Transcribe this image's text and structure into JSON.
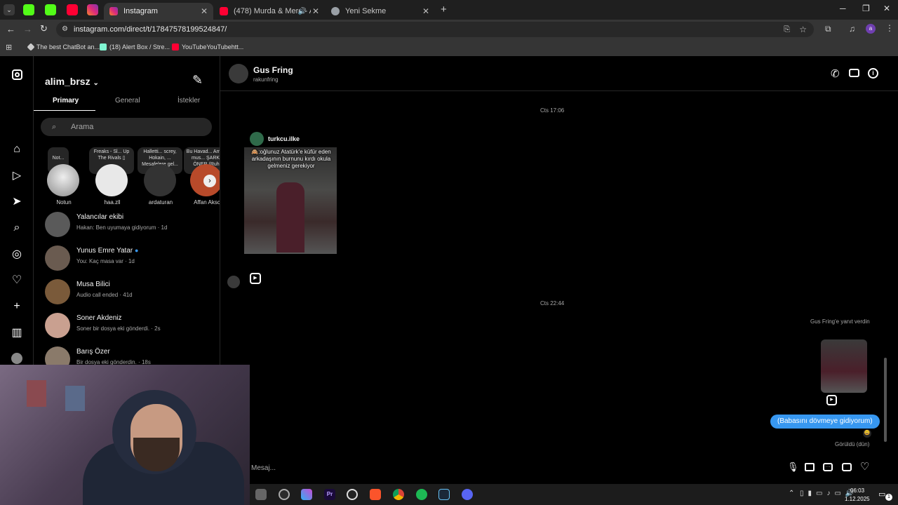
{
  "browser": {
    "tabs": [
      {
        "title": "Instagram",
        "active": true
      },
      {
        "title": "(478) Murda & Mero - Ara",
        "active": false
      },
      {
        "title": "Yeni Sekme",
        "active": false
      }
    ],
    "url": "instagram.com/direct/t/17847578199524847/",
    "bookmarks": [
      "The best ChatBot an...",
      "(18) Alert Box / Stre...",
      "YouTubeYouTubehtt..."
    ],
    "profile_initial": "a"
  },
  "inbox": {
    "username": "alim_brsz",
    "tabs": [
      "Primary",
      "General",
      "İstekler"
    ],
    "search_placeholder": "Arama",
    "notes": [
      {
        "bubble": "Not...",
        "name": "Notun"
      },
      {
        "bubble": "Freaks - Sl... Up The Rivals ▯",
        "name": "haa.zll"
      },
      {
        "bubble": "Halletti... screy, Hokain, ... Mesafelere gel...",
        "name": "ardaturan"
      },
      {
        "bubble": "Bu Havad... Armin mus... ŞARKI ÖNER (Ruh halinizi",
        "name": "Affan Aksc"
      }
    ],
    "conversations": [
      {
        "name": "Yalancılar ekibi",
        "preview": "Hakan: Ben uyumaya gidiyorum · 1d"
      },
      {
        "name": "Yunus Emre Yatar",
        "preview": "You: Kaç masa var · 1d",
        "verified": true
      },
      {
        "name": "Musa Bilici",
        "preview": "Audio call ended · 41d"
      },
      {
        "name": "Soner Akdeniz",
        "preview": "Soner bir dosya eki gönderdi. · 2s"
      },
      {
        "name": "Barış Özer",
        "preview": "Bir dosya eki gönderdin. · 18s"
      }
    ]
  },
  "chat": {
    "contact_name": "Gus Fring",
    "contact_handle": "rakunfring",
    "timestamp_1": "Cts 17:06",
    "shared_post_account": "turkcu.ilke",
    "shared_post_caption": "🙈:oğlunuz Atatürk'e küfür eden arkadaşının burnunu kırdı okula gelmeniz gerekiyor",
    "timestamp_2": "Cts 22:44",
    "reply_label": "Gus Fring'e yanıt verdin",
    "sent_message": "(Babasını dövmeye gidiyorum)",
    "seen_label": "Görüldü (dün)",
    "composer_placeholder": "Mesaj..."
  },
  "taskbar": {
    "time": "06:03",
    "date": "1.12.2025",
    "notification_count": "1"
  },
  "colors": {
    "sent_bubble": "#3797f0",
    "instagram_bg": "#000000",
    "chrome_bg": "#353535"
  }
}
